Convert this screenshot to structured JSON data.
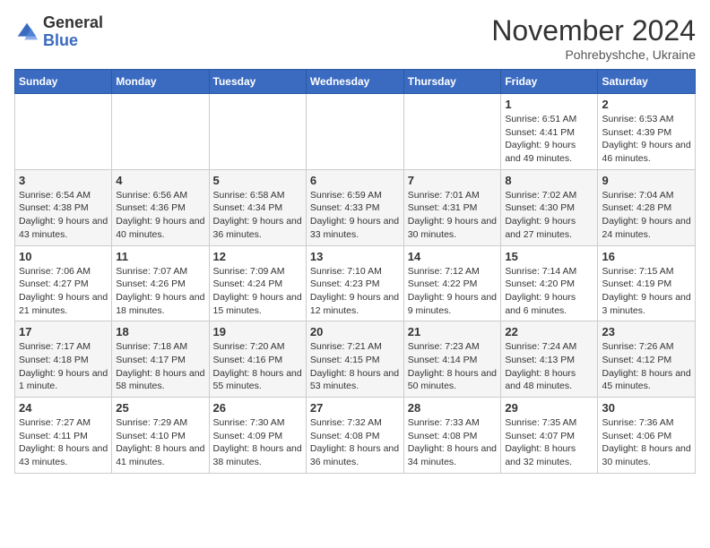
{
  "logo": {
    "general": "General",
    "blue": "Blue"
  },
  "header": {
    "month": "November 2024",
    "location": "Pohrebyshche, Ukraine"
  },
  "weekdays": [
    "Sunday",
    "Monday",
    "Tuesday",
    "Wednesday",
    "Thursday",
    "Friday",
    "Saturday"
  ],
  "weeks": [
    [
      {
        "day": "",
        "info": ""
      },
      {
        "day": "",
        "info": ""
      },
      {
        "day": "",
        "info": ""
      },
      {
        "day": "",
        "info": ""
      },
      {
        "day": "",
        "info": ""
      },
      {
        "day": "1",
        "info": "Sunrise: 6:51 AM\nSunset: 4:41 PM\nDaylight: 9 hours and 49 minutes."
      },
      {
        "day": "2",
        "info": "Sunrise: 6:53 AM\nSunset: 4:39 PM\nDaylight: 9 hours and 46 minutes."
      }
    ],
    [
      {
        "day": "3",
        "info": "Sunrise: 6:54 AM\nSunset: 4:38 PM\nDaylight: 9 hours and 43 minutes."
      },
      {
        "day": "4",
        "info": "Sunrise: 6:56 AM\nSunset: 4:36 PM\nDaylight: 9 hours and 40 minutes."
      },
      {
        "day": "5",
        "info": "Sunrise: 6:58 AM\nSunset: 4:34 PM\nDaylight: 9 hours and 36 minutes."
      },
      {
        "day": "6",
        "info": "Sunrise: 6:59 AM\nSunset: 4:33 PM\nDaylight: 9 hours and 33 minutes."
      },
      {
        "day": "7",
        "info": "Sunrise: 7:01 AM\nSunset: 4:31 PM\nDaylight: 9 hours and 30 minutes."
      },
      {
        "day": "8",
        "info": "Sunrise: 7:02 AM\nSunset: 4:30 PM\nDaylight: 9 hours and 27 minutes."
      },
      {
        "day": "9",
        "info": "Sunrise: 7:04 AM\nSunset: 4:28 PM\nDaylight: 9 hours and 24 minutes."
      }
    ],
    [
      {
        "day": "10",
        "info": "Sunrise: 7:06 AM\nSunset: 4:27 PM\nDaylight: 9 hours and 21 minutes."
      },
      {
        "day": "11",
        "info": "Sunrise: 7:07 AM\nSunset: 4:26 PM\nDaylight: 9 hours and 18 minutes."
      },
      {
        "day": "12",
        "info": "Sunrise: 7:09 AM\nSunset: 4:24 PM\nDaylight: 9 hours and 15 minutes."
      },
      {
        "day": "13",
        "info": "Sunrise: 7:10 AM\nSunset: 4:23 PM\nDaylight: 9 hours and 12 minutes."
      },
      {
        "day": "14",
        "info": "Sunrise: 7:12 AM\nSunset: 4:22 PM\nDaylight: 9 hours and 9 minutes."
      },
      {
        "day": "15",
        "info": "Sunrise: 7:14 AM\nSunset: 4:20 PM\nDaylight: 9 hours and 6 minutes."
      },
      {
        "day": "16",
        "info": "Sunrise: 7:15 AM\nSunset: 4:19 PM\nDaylight: 9 hours and 3 minutes."
      }
    ],
    [
      {
        "day": "17",
        "info": "Sunrise: 7:17 AM\nSunset: 4:18 PM\nDaylight: 9 hours and 1 minute."
      },
      {
        "day": "18",
        "info": "Sunrise: 7:18 AM\nSunset: 4:17 PM\nDaylight: 8 hours and 58 minutes."
      },
      {
        "day": "19",
        "info": "Sunrise: 7:20 AM\nSunset: 4:16 PM\nDaylight: 8 hours and 55 minutes."
      },
      {
        "day": "20",
        "info": "Sunrise: 7:21 AM\nSunset: 4:15 PM\nDaylight: 8 hours and 53 minutes."
      },
      {
        "day": "21",
        "info": "Sunrise: 7:23 AM\nSunset: 4:14 PM\nDaylight: 8 hours and 50 minutes."
      },
      {
        "day": "22",
        "info": "Sunrise: 7:24 AM\nSunset: 4:13 PM\nDaylight: 8 hours and 48 minutes."
      },
      {
        "day": "23",
        "info": "Sunrise: 7:26 AM\nSunset: 4:12 PM\nDaylight: 8 hours and 45 minutes."
      }
    ],
    [
      {
        "day": "24",
        "info": "Sunrise: 7:27 AM\nSunset: 4:11 PM\nDaylight: 8 hours and 43 minutes."
      },
      {
        "day": "25",
        "info": "Sunrise: 7:29 AM\nSunset: 4:10 PM\nDaylight: 8 hours and 41 minutes."
      },
      {
        "day": "26",
        "info": "Sunrise: 7:30 AM\nSunset: 4:09 PM\nDaylight: 8 hours and 38 minutes."
      },
      {
        "day": "27",
        "info": "Sunrise: 7:32 AM\nSunset: 4:08 PM\nDaylight: 8 hours and 36 minutes."
      },
      {
        "day": "28",
        "info": "Sunrise: 7:33 AM\nSunset: 4:08 PM\nDaylight: 8 hours and 34 minutes."
      },
      {
        "day": "29",
        "info": "Sunrise: 7:35 AM\nSunset: 4:07 PM\nDaylight: 8 hours and 32 minutes."
      },
      {
        "day": "30",
        "info": "Sunrise: 7:36 AM\nSunset: 4:06 PM\nDaylight: 8 hours and 30 minutes."
      }
    ]
  ]
}
